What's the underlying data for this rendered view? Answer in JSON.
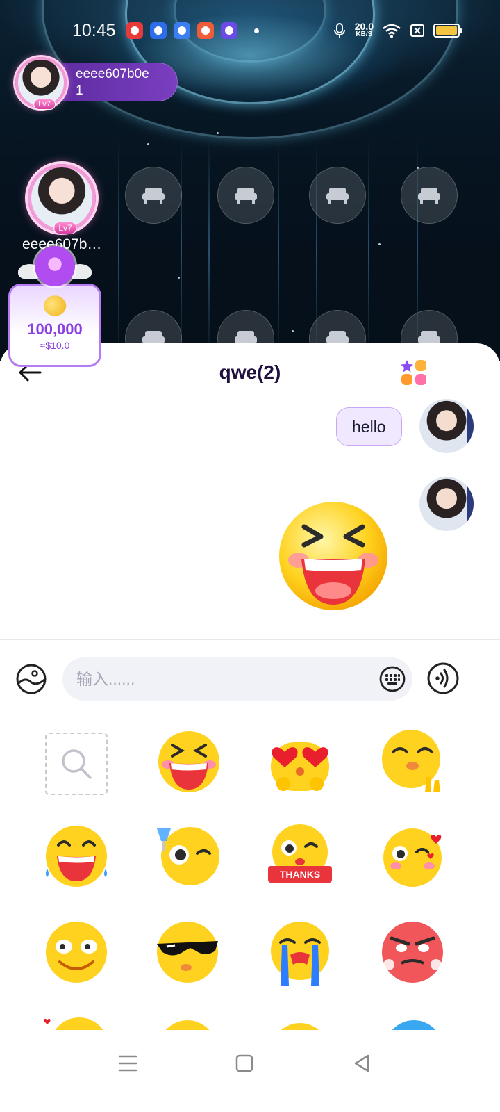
{
  "status_bar": {
    "time": "10:45",
    "net_speed_value": "20.0",
    "net_speed_unit": "KB/S",
    "app_icons": [
      "baidu-app-icon",
      "player-app-icon",
      "browser-app-icon",
      "game-app-icon",
      "planet-app-icon"
    ],
    "battery_color": "#f5c542"
  },
  "room": {
    "host_name": "eeee607b0e",
    "host_count": "1",
    "host_level": "Lv7",
    "seat_owner_name": "eeee607b…",
    "seat_owner_level": "Lv7",
    "empty_seats_row1": 4,
    "empty_seats_row2": 4
  },
  "coin_card": {
    "amount": "100,000",
    "usd": "≈$10.0"
  },
  "chat": {
    "title": "qwe(2)",
    "messages": [
      {
        "type": "text",
        "text": "hello",
        "from": "me"
      },
      {
        "type": "sticker",
        "sticker": "laughing-squint-emoji",
        "from": "me"
      }
    ],
    "bubble_color": "#f0e8ff",
    "accent": "#8a3fe0"
  },
  "input": {
    "placeholder": "输入......",
    "value": ""
  },
  "emoji_panel": {
    "search_icon": "search-icon",
    "rows": [
      [
        "laughing-squint-emoji",
        "heart-eyes-emoji",
        "shy-hands-emoji"
      ],
      [
        "tears-of-joy-emoji",
        "cheers-wink-emoji",
        "thanks-sign-emoji",
        "wink-heart-emoji"
      ],
      [
        "silly-eyes-emoji",
        "sunglasses-emoji",
        "crying-emoji",
        "angry-red-emoji"
      ]
    ],
    "thanks_label": "THANKS"
  },
  "nav_bar": {
    "buttons": [
      "menu-icon",
      "home-icon",
      "back-triangle-icon"
    ]
  }
}
